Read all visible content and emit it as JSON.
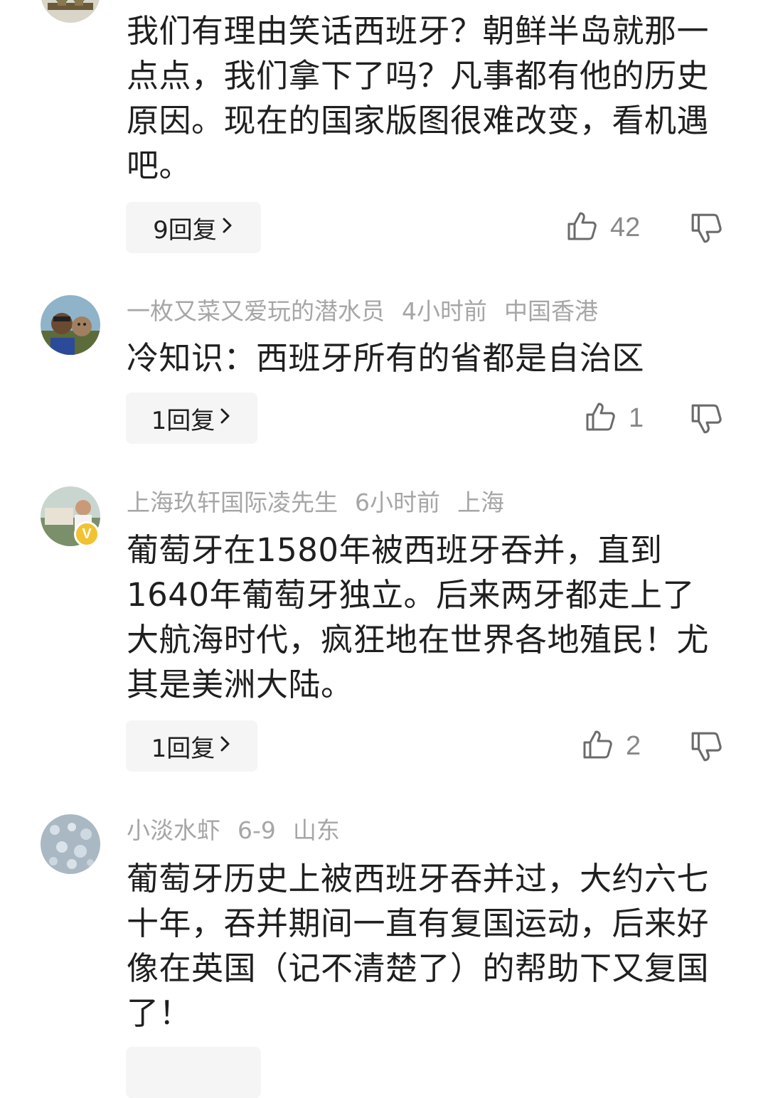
{
  "comments": [
    {
      "text": "我们有理由笑话西班牙？朝鲜半岛就那一点点，我们拿下了吗？凡事都有他的历史原因。现在的国家版图很难改变，看机遇吧。",
      "replies": "9回复",
      "likes": "42",
      "avatar_icon": "plant-avatar"
    },
    {
      "username": "一枚又菜又爱玩的潜水员",
      "time": "4小时前",
      "location": "中国香港",
      "text": "冷知识：西班牙所有的省都是自治区",
      "replies": "1回复",
      "likes": "1",
      "avatar_icon": "selfie-avatar"
    },
    {
      "username": "上海玖轩国际凌先生",
      "time": "6小时前",
      "location": "上海",
      "verified_badge": "V",
      "text": "葡萄牙在1580年被西班牙吞并，直到1640年葡萄牙独立。后来两牙都走上了大航海时代，疯狂地在世界各地殖民！尤其是美洲大陆。",
      "replies": "1回复",
      "likes": "2",
      "avatar_icon": "person-photo-avatar"
    },
    {
      "username": "小淡水虾",
      "time": "6-9",
      "location": "山东",
      "text": "葡萄牙历史上被西班牙吞并过，大约六七十年，吞并期间一直有复国运动，后来好像在英国（记不清楚了）的帮助下又复国了！",
      "avatar_icon": "water-drops-avatar"
    }
  ],
  "icons": {
    "reply_arrow": "chevron-right-icon",
    "like": "thumbs-up-icon",
    "dislike": "thumbs-down-icon"
  },
  "colors": {
    "meta_text": "#a6a6a6",
    "body_text": "#1f1f1f",
    "reply_bg": "#f5f5f5",
    "badge": "#f2c230"
  }
}
